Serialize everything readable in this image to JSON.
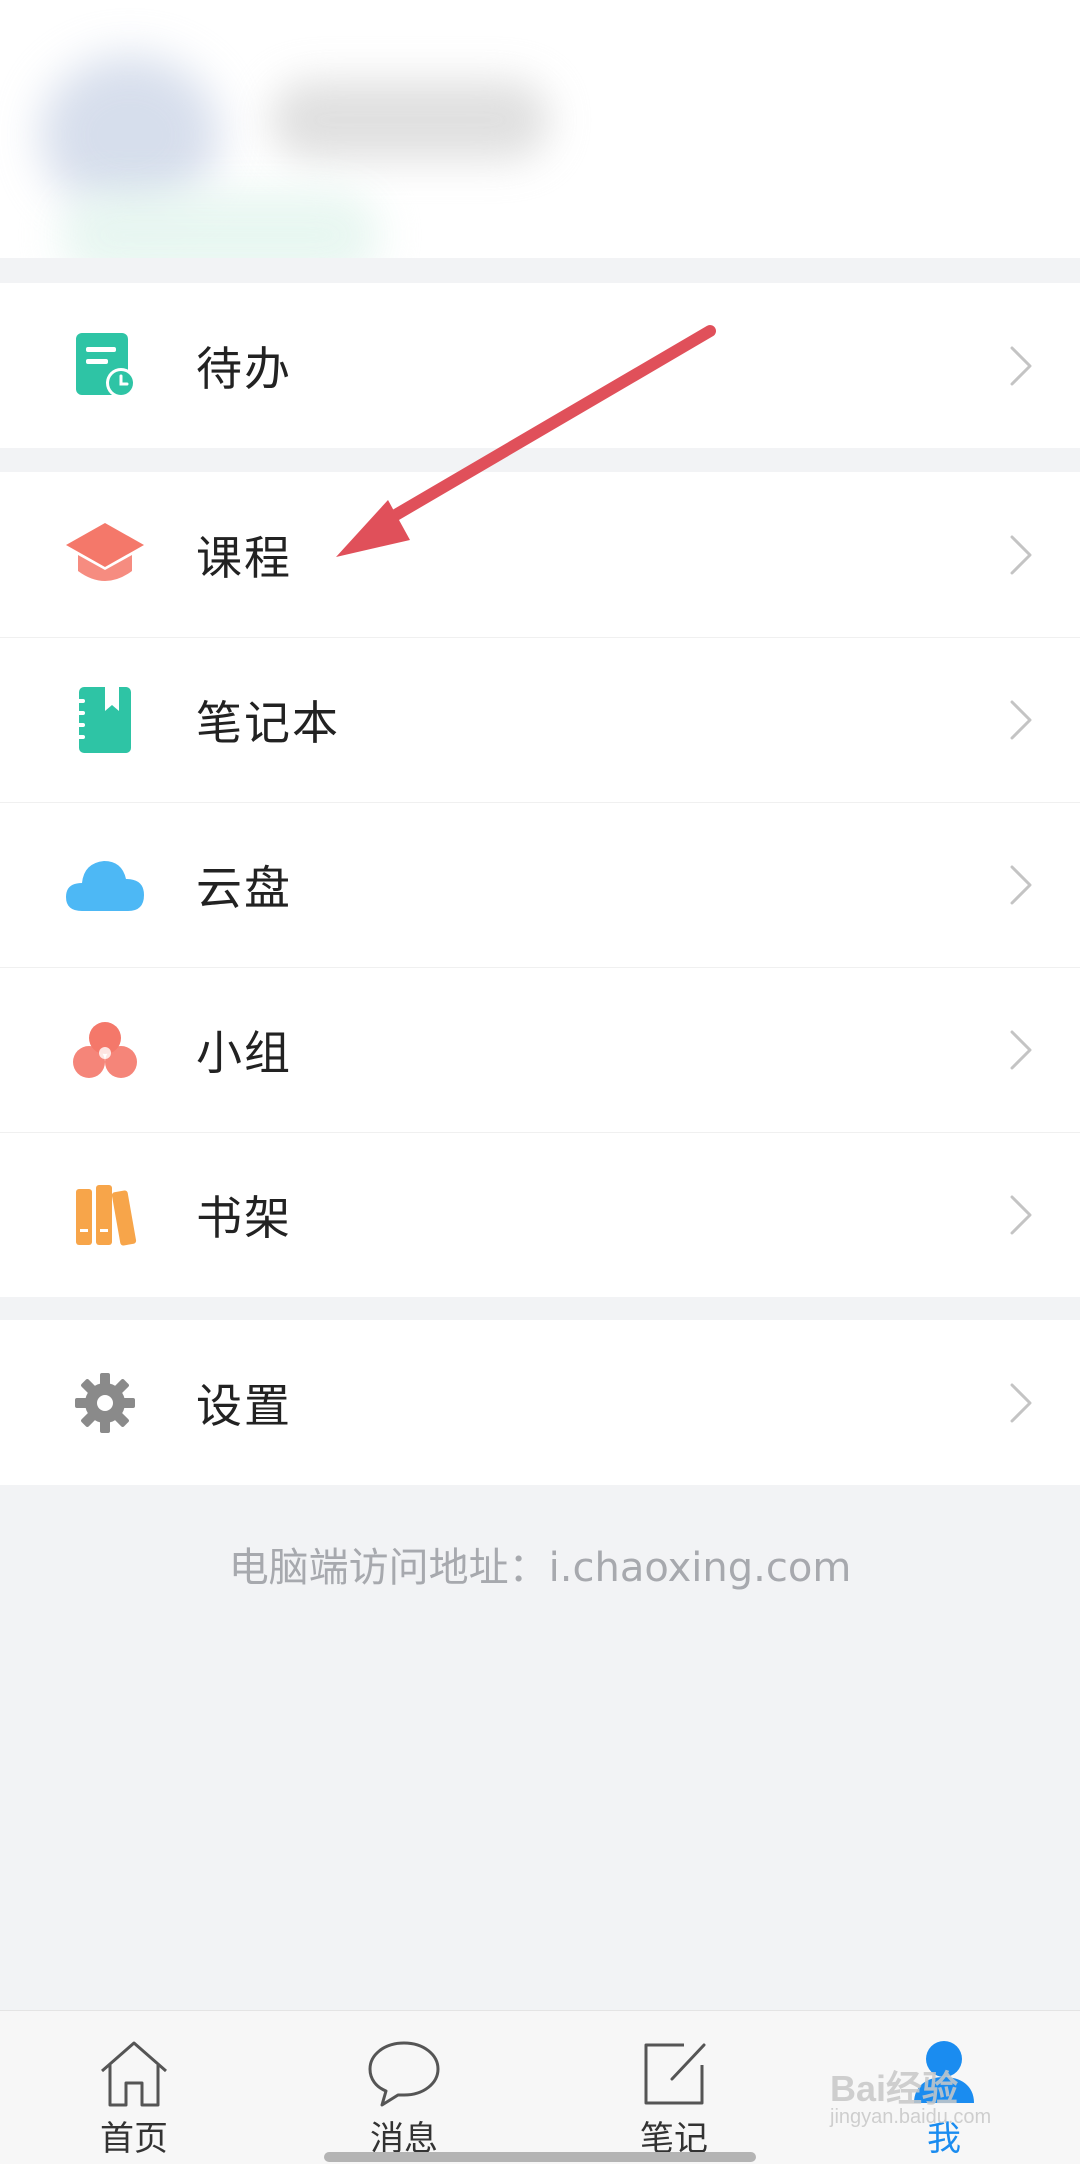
{
  "menu": {
    "todo": {
      "label": "待办",
      "icon": "todo-clock-icon",
      "color": "#2ec4a5"
    },
    "course": {
      "label": "课程",
      "icon": "graduation-cap-icon",
      "color": "#f4786a"
    },
    "notebook": {
      "label": "笔记本",
      "icon": "notebook-icon",
      "color": "#2ec4a5"
    },
    "cloud": {
      "label": "云盘",
      "icon": "cloud-icon",
      "color": "#4db8f5"
    },
    "group": {
      "label": "小组",
      "icon": "group-circles-icon",
      "color": "#f4786a"
    },
    "bookshelf": {
      "label": "书架",
      "icon": "bookshelf-icon",
      "color": "#f7a54a"
    },
    "settings": {
      "label": "设置",
      "icon": "gear-icon",
      "color": "#8a8a8a"
    }
  },
  "footer": {
    "web_access": "电脑端访问地址：i.chaoxing.com"
  },
  "tabbar": {
    "home": "首页",
    "messages": "消息",
    "notes": "笔记",
    "me": "我",
    "active_color": "#1a8cf0"
  },
  "watermark": {
    "brand": "Bai经验",
    "site": "jingyan.baidu.com"
  }
}
